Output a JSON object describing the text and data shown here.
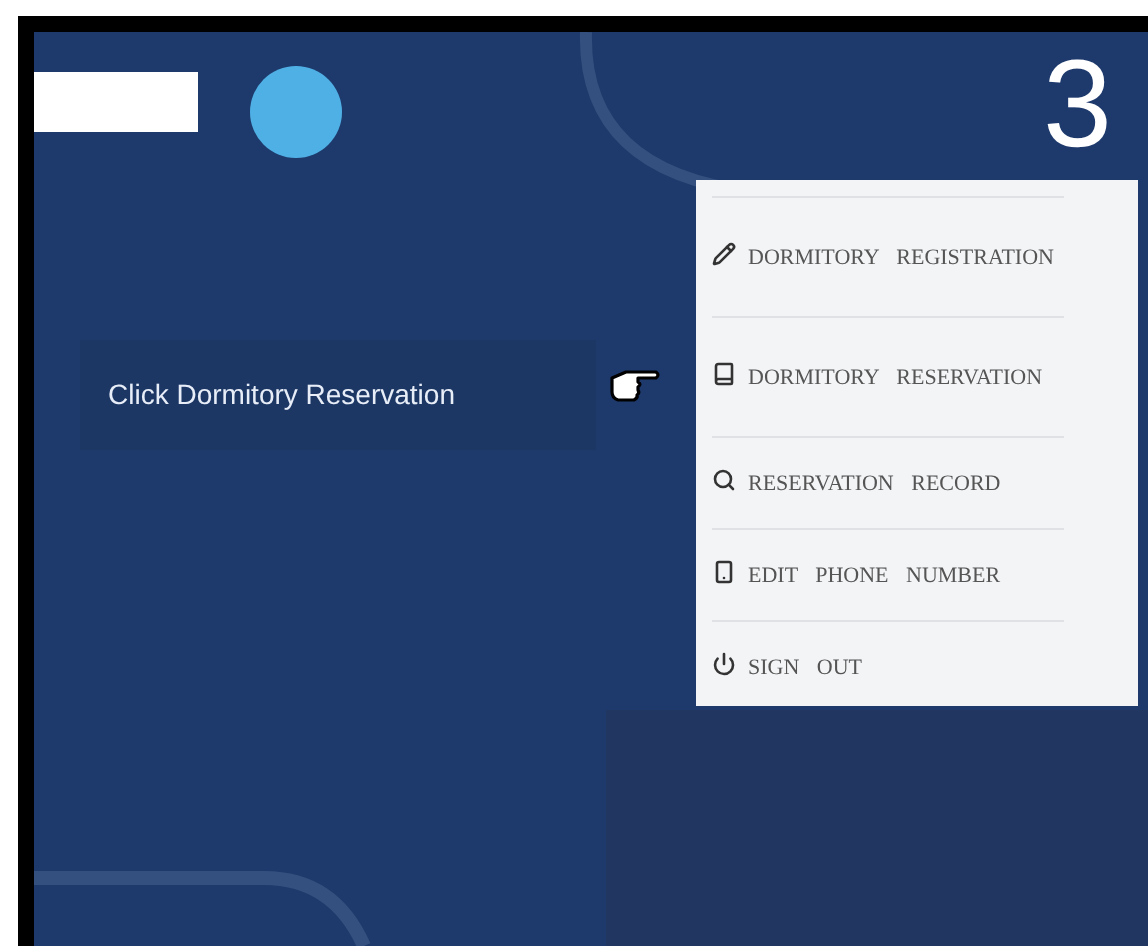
{
  "step": "3",
  "callout": {
    "text": "Click Dormitory Reservation"
  },
  "menu": {
    "items": [
      {
        "label": "DORMITORY REGISTRATION",
        "kind": "pencil"
      },
      {
        "label": "DORMITORY RESERVATION",
        "kind": "book"
      },
      {
        "label": "RESERVATION RECORD",
        "kind": "search"
      },
      {
        "label": "EDIT PHONE NUMBER",
        "kind": "phone"
      },
      {
        "label": "SIGN OUT",
        "kind": "power"
      }
    ]
  }
}
